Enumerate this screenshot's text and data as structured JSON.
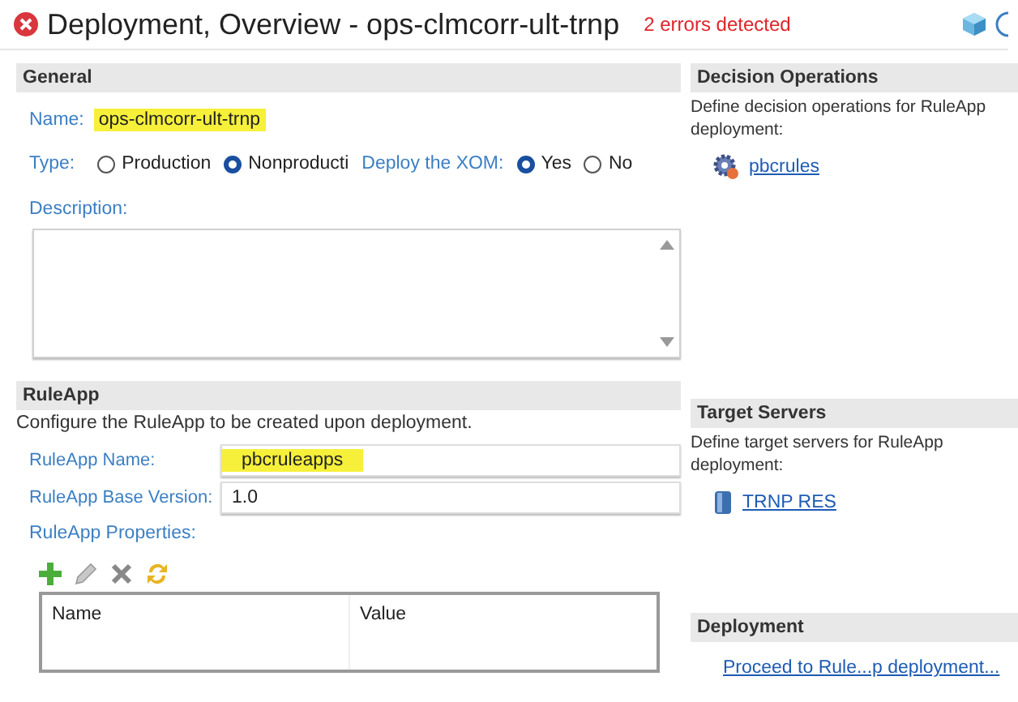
{
  "window": {
    "title": "Deployment, Overview - ops-clmcorr-ult-trnp",
    "status": "2 errors detected"
  },
  "general": {
    "header": "General",
    "name": {
      "label": "Name:",
      "value": "ops-clmcorr-ult-trnp",
      "highlighted": true
    },
    "type": {
      "label": "Type:",
      "options": [
        {
          "label": "Production",
          "selected": false
        },
        {
          "label": "Nonproducti",
          "selected": true
        }
      ]
    },
    "deploy_xom": {
      "label": "Deploy the XOM:",
      "options": [
        {
          "label": "Yes",
          "selected": true
        },
        {
          "label": "No",
          "selected": false
        }
      ]
    },
    "description": {
      "label": "Description:"
    }
  },
  "ruleapp": {
    "header": "RuleApp",
    "text": "Configure the RuleApp to be created upon deployment.",
    "fields": [
      {
        "label": "RuleApp Name:",
        "value": "pbcruleapps",
        "highlighted": true
      },
      {
        "label": "RuleApp Base Version:",
        "value": "1.0",
        "highlighted": false
      }
    ],
    "properties_label": "RuleApp Properties:",
    "table": {
      "columns": [
        "Name",
        "Value"
      ]
    }
  },
  "decision_operations": {
    "header": "Decision Operations",
    "text": "Define decision operations for RuleApp deployment:",
    "link": "pbcrules"
  },
  "target_servers": {
    "header": "Target Servers",
    "text": "Define target servers for RuleApp deployment:",
    "link": "TRNP RES"
  },
  "deployment": {
    "header": "Deployment",
    "link": "Proceed to Rule...p deployment..."
  }
}
